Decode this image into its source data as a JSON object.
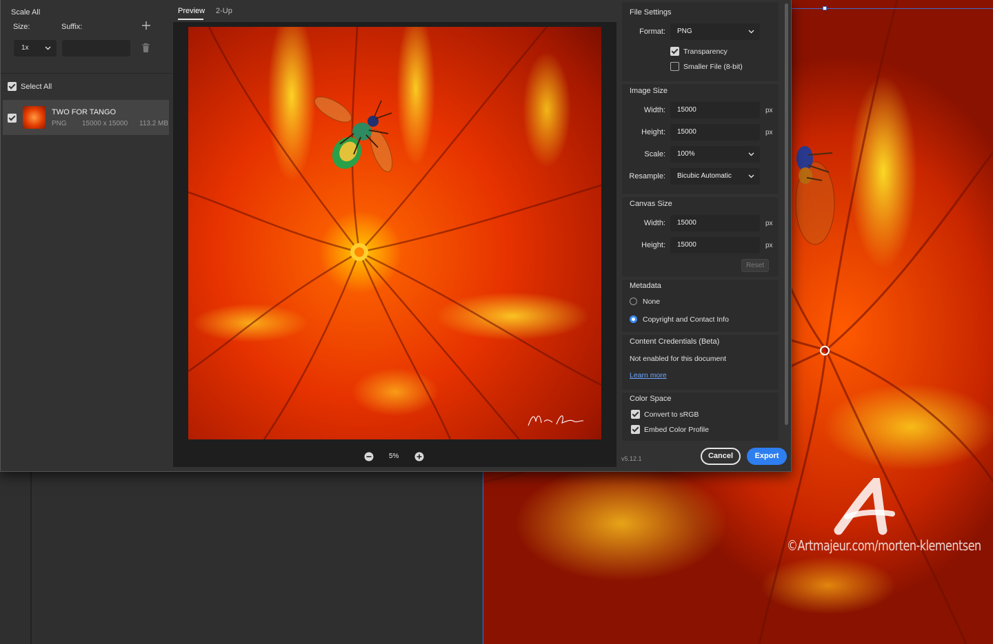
{
  "left_panel": {
    "scale_all_label": "Scale All",
    "size_label": "Size:",
    "suffix_label": "Suffix:",
    "size_value": "1x",
    "suffix_value": "",
    "select_all_label": "Select All",
    "select_all_checked": true,
    "asset": {
      "name": "TWO FOR TANGO",
      "format": "PNG",
      "dimensions": "15000 x 15000",
      "file_size": "113.2 MB",
      "checked": true
    }
  },
  "preview": {
    "tabs": [
      {
        "label": "Preview",
        "active": true
      },
      {
        "label": "2-Up",
        "active": false
      }
    ],
    "zoom_level": "5%"
  },
  "settings": {
    "file_settings": {
      "title": "File Settings",
      "format_label": "Format:",
      "format_value": "PNG",
      "transparency_label": "Transparency",
      "transparency_checked": true,
      "smaller_file_label": "Smaller File (8-bit)",
      "smaller_file_checked": false
    },
    "image_size": {
      "title": "Image Size",
      "width_label": "Width:",
      "width_value": "15000",
      "width_unit": "px",
      "height_label": "Height:",
      "height_value": "15000",
      "height_unit": "px",
      "scale_label": "Scale:",
      "scale_value": "100%",
      "resample_label": "Resample:",
      "resample_value": "Bicubic Automatic"
    },
    "canvas_size": {
      "title": "Canvas Size",
      "width_label": "Width:",
      "width_value": "15000",
      "width_unit": "px",
      "height_label": "Height:",
      "height_value": "15000",
      "height_unit": "px",
      "reset_label": "Reset"
    },
    "metadata": {
      "title": "Metadata",
      "options": [
        {
          "label": "None",
          "selected": false
        },
        {
          "label": "Copyright and Contact Info",
          "selected": true
        }
      ]
    },
    "content_credentials": {
      "title": "Content Credentials (Beta)",
      "status": "Not enabled for this document",
      "link_label": "Learn more"
    },
    "color_space": {
      "title": "Color Space",
      "convert_label": "Convert to sRGB",
      "convert_checked": true,
      "embed_label": "Embed Color Profile",
      "embed_checked": true
    },
    "version": "v5.12.1",
    "cancel_label": "Cancel",
    "export_label": "Export"
  },
  "watermark": {
    "text": "©Artmajeur.com/morten-klementsen"
  },
  "colors": {
    "accent": "#2e7ef0",
    "panel": "#323232",
    "field": "#262626",
    "selection_blue": "#3b6fd0"
  }
}
